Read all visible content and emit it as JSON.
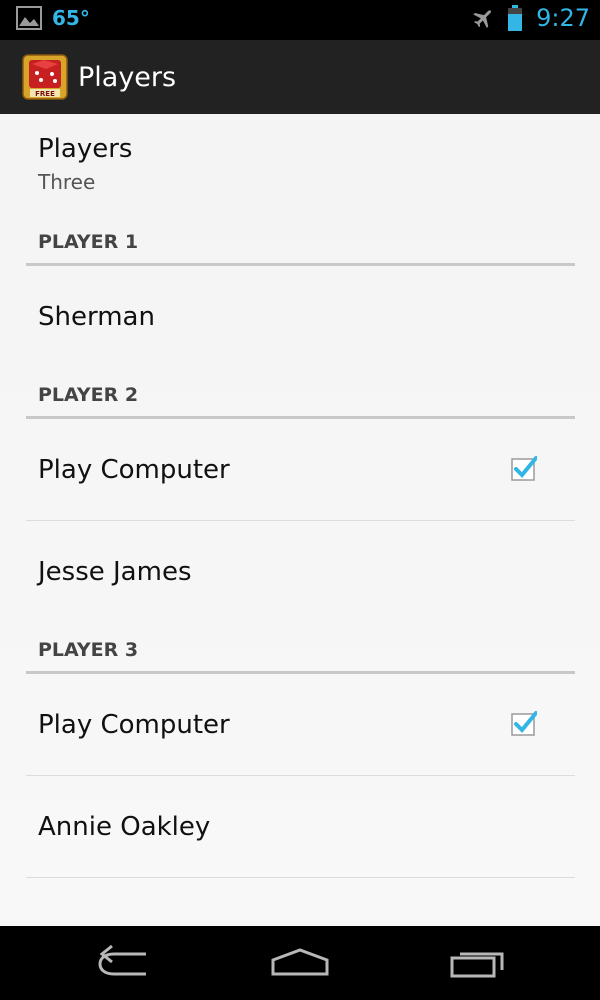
{
  "status_bar": {
    "temperature": "65°",
    "time": "9:27",
    "icons": [
      "gallery-icon",
      "airplane-icon",
      "battery-icon"
    ]
  },
  "action_bar": {
    "title": "Players",
    "app_icon": "dice-free-icon"
  },
  "players_pref": {
    "title": "Players",
    "summary": "Three"
  },
  "sections": [
    {
      "header": "PLAYER 1",
      "name": "Sherman"
    },
    {
      "header": "PLAYER 2",
      "play_computer_label": "Play Computer",
      "play_computer_checked": true,
      "name": "Jesse James"
    },
    {
      "header": "PLAYER 3",
      "play_computer_label": "Play Computer",
      "play_computer_checked": true,
      "name": "Annie Oakley"
    }
  ],
  "nav_bar": {
    "icons": [
      "back-icon",
      "home-icon",
      "recent-apps-icon"
    ]
  },
  "colors": {
    "accent": "#33b5e5",
    "action_bar": "#222222",
    "background": "#f4f4f4"
  }
}
